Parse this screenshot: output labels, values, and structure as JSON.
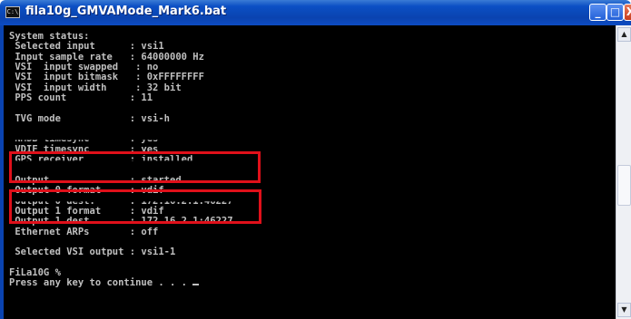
{
  "window": {
    "title": "fila10g_GMVAMode_Mark6.bat",
    "icon_label": "C:\\",
    "buttons": {
      "minimize": "_",
      "maximize": "□",
      "close": "X"
    }
  },
  "console": {
    "lines": [
      "System status:",
      " Selected input      : vsi1",
      " Input sample rate   : 64000000 Hz",
      " VSI  input swapped   : no",
      " VSI  input bitmask   : 0xFFFFFFFF",
      " VSI  input width     : 32 bit",
      " PPS count           : 11",
      "",
      " TVG mode            : vsi-h",
      "",
      " NMSB timesync       : yes",
      " VDIF timesync       : yes",
      " GPS receiver        : installed",
      "",
      " Output              : started",
      " Output 0 format     : vdif",
      " Output 0 dest.      : 172.16.2.1:46227",
      " Output 1 format     : vdif",
      " Output 1 dest.      : 172.16.2.1:46227",
      " Ethernet ARPs       : off",
      "",
      " Selected VSI output : vsi1-1",
      "",
      "FiLa10G %",
      "Press any key to continue . . . "
    ]
  },
  "scrollbar": {
    "up_arrow": "▲",
    "down_arrow": "▼"
  },
  "highlight_color": "#e0101a"
}
